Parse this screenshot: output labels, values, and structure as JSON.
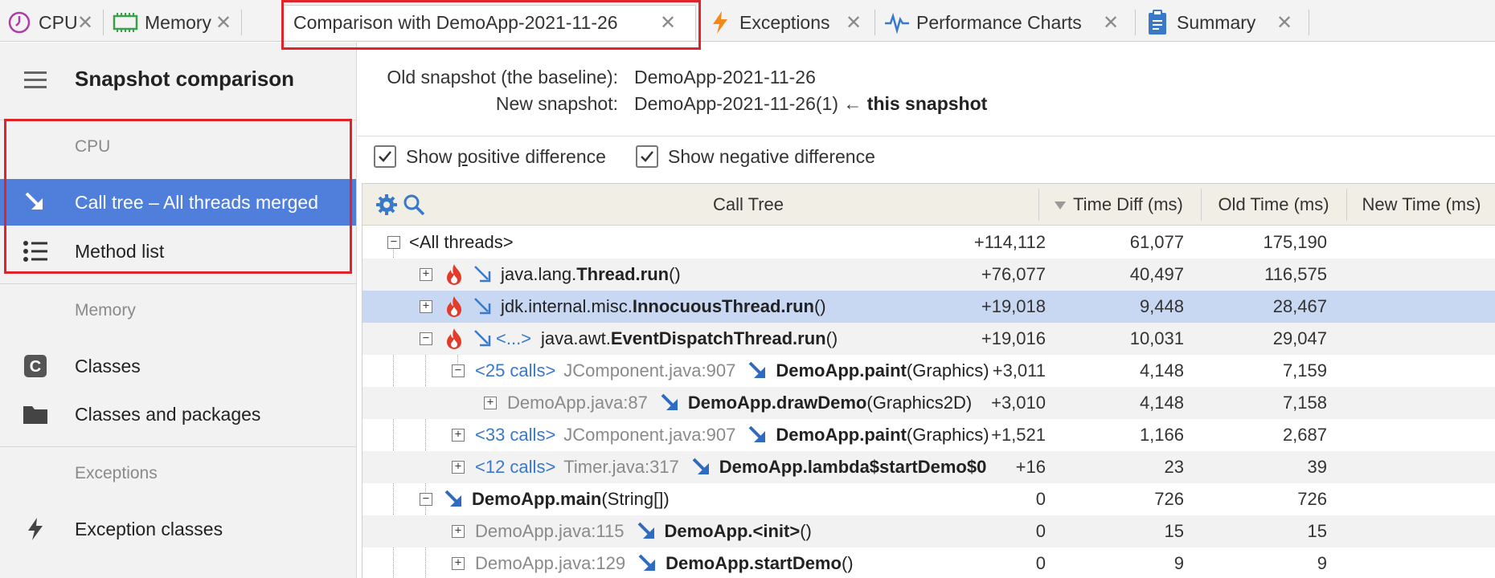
{
  "tabs": [
    {
      "label": "CPU",
      "icon": "clock-icon",
      "color": "#b03aa8"
    },
    {
      "label": "Memory",
      "icon": "memory-chip-icon",
      "color": "#3aa04a"
    },
    {
      "label": "Comparison with DemoApp-2021-11-26",
      "icon": "",
      "active": true
    },
    {
      "label": "Exceptions",
      "icon": "lightning-icon",
      "color": "#f28a1a"
    },
    {
      "label": "Performance Charts",
      "icon": "pulse-icon",
      "color": "#3a78c9"
    },
    {
      "label": "Summary",
      "icon": "clipboard-icon",
      "color": "#3a78c9"
    }
  ],
  "sidebar": {
    "title": "Snapshot comparison",
    "sections": {
      "cpu": "CPU",
      "memory": "Memory",
      "exceptions": "Exceptions"
    },
    "items": [
      {
        "label": "Call tree – All threads merged",
        "icon": "call-tree-arrow-icon",
        "selected": true
      },
      {
        "label": "Method list",
        "icon": "list-icon"
      },
      {
        "label": "Classes",
        "icon": "class-c-icon"
      },
      {
        "label": "Classes and packages",
        "icon": "folder-icon"
      },
      {
        "label": "Exception classes",
        "icon": "lightning-icon"
      }
    ]
  },
  "snapshots": {
    "old_label": "Old snapshot (the baseline):",
    "old_value": "DemoApp-2021-11-26",
    "new_label": "New snapshot:",
    "new_value": "DemoApp-2021-11-26(1)",
    "new_arrow": "←",
    "new_note": "this snapshot"
  },
  "filters": {
    "positive": {
      "pre": "Show ",
      "ul": "p",
      "post": "ositive difference",
      "checked": true
    },
    "negative": {
      "pre": "Show ne",
      "ul": "g",
      "post": "ative difference",
      "checked": true
    }
  },
  "table": {
    "columns": {
      "tree": "Call Tree",
      "diff": "Time Diff (ms)",
      "old": "Old Time (ms)",
      "new": "New Time (ms)"
    },
    "rows": [
      {
        "prefix": "",
        "loc": "",
        "pkg": "",
        "cls": "",
        "method": "",
        "text": "<All threads>",
        "args": "",
        "diff": "+114,112",
        "old": "61,077",
        "new": "175,190"
      },
      {
        "prefix": "",
        "loc": "",
        "pkg": "java.lang.",
        "cls": "Thread",
        "method": ".run",
        "args": "()",
        "diff": "+76,077",
        "old": "40,497",
        "new": "116,575"
      },
      {
        "prefix": "",
        "loc": "",
        "pkg": "jdk.internal.misc.",
        "cls": "InnocuousThread",
        "method": ".run",
        "args": "()",
        "diff": "+19,018",
        "old": "9,448",
        "new": "28,467"
      },
      {
        "prefix": "<...>",
        "loc": "",
        "pkg": "java.awt.",
        "cls": "EventDispatchThread",
        "method": ".run",
        "args": "()",
        "diff": "+19,016",
        "old": "10,031",
        "new": "29,047"
      },
      {
        "prefix": "<25 calls>",
        "loc": "JComponent.java:907",
        "pkg": "",
        "cls": "DemoApp",
        "method": ".paint",
        "args": "(Graphics)",
        "diff": "+3,011",
        "old": "4,148",
        "new": "7,159"
      },
      {
        "prefix": "",
        "loc": "DemoApp.java:87",
        "pkg": "",
        "cls": "DemoApp",
        "method": ".drawDemo",
        "args": "(Graphics2D)",
        "diff": "+3,010",
        "old": "4,148",
        "new": "7,158"
      },
      {
        "prefix": "<33 calls>",
        "loc": "JComponent.java:907",
        "pkg": "",
        "cls": "DemoApp",
        "method": ".paint",
        "args": "(Graphics)",
        "diff": "+1,521",
        "old": "1,166",
        "new": "2,687"
      },
      {
        "prefix": "<12 calls>",
        "loc": "Timer.java:317",
        "pkg": "",
        "cls": "DemoApp",
        "method": ".lambda$startDemo$0",
        "args": "",
        "diff": "+16",
        "old": "23",
        "new": "39"
      },
      {
        "prefix": "",
        "loc": "",
        "pkg": "",
        "cls": "DemoApp",
        "method": ".main",
        "args": "(String[])",
        "diff": "0",
        "old": "726",
        "new": "726"
      },
      {
        "prefix": "",
        "loc": "DemoApp.java:115",
        "pkg": "",
        "cls": "DemoApp",
        "method": ".<init>",
        "args": "()",
        "diff": "0",
        "old": "15",
        "new": "15"
      },
      {
        "prefix": "",
        "loc": "DemoApp.java:129",
        "pkg": "",
        "cls": "DemoApp",
        "method": ".startDemo",
        "args": "()",
        "diff": "0",
        "old": "9",
        "new": "9"
      }
    ]
  },
  "colors": {
    "accent": "#4f7fdb",
    "selected_row": "#c8d7f2",
    "highlight_box": "#e0252a",
    "hot": "#e23b2a"
  }
}
